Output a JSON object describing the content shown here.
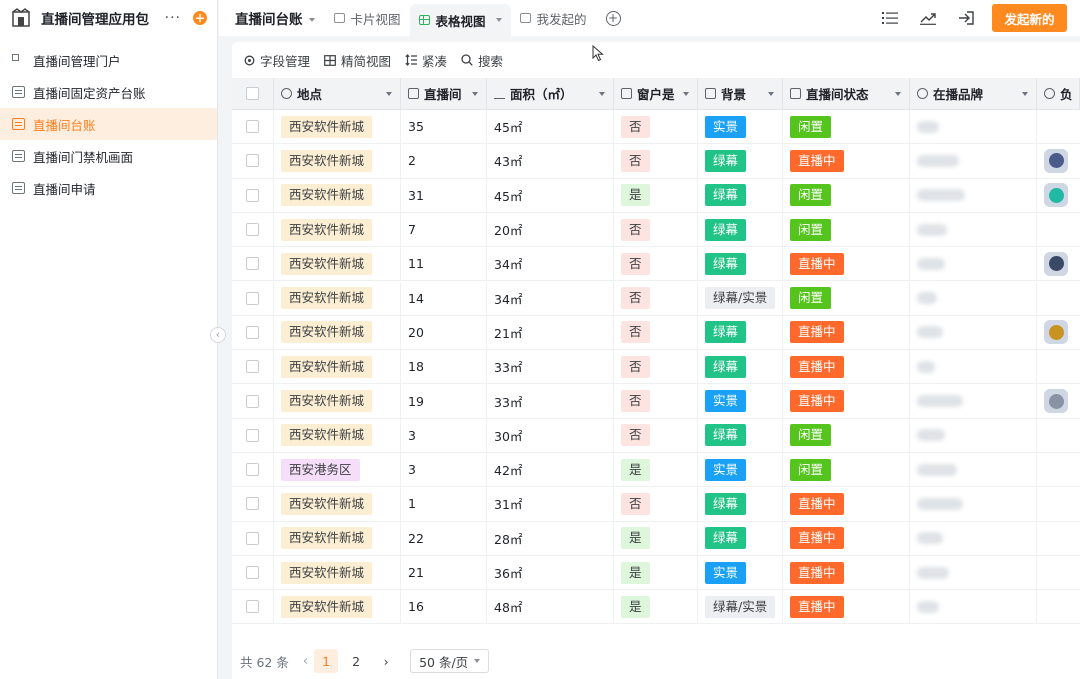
{
  "app": {
    "title": "直播间管理应用包",
    "more": "···",
    "add": "+"
  },
  "sidebar": {
    "items": [
      {
        "label": "直播间管理门户",
        "icon": "portal-icon",
        "active": false
      },
      {
        "label": "直播间固定资产台账",
        "icon": "table-icon",
        "active": false
      },
      {
        "label": "直播间台账",
        "icon": "table-icon",
        "active": true
      },
      {
        "label": "直播间门禁机画面",
        "icon": "table-icon",
        "active": false
      },
      {
        "label": "直播间申请",
        "icon": "table-icon",
        "active": false
      }
    ],
    "collapse": "‹"
  },
  "topbar": {
    "title": "直播间台账",
    "tabs": [
      {
        "label": "卡片视图",
        "active": false
      },
      {
        "label": "表格视图",
        "active": true
      },
      {
        "label": "我发起的",
        "active": false
      }
    ],
    "add_tab": "+",
    "primary_button": "发起新的"
  },
  "toolbar": {
    "field_manage": "字段管理",
    "simple_view": "精简视图",
    "compact": "紧凑",
    "search": "搜索"
  },
  "table": {
    "columns": [
      "地点",
      "直播间",
      "面积（㎡）",
      "窗户是",
      "背景",
      "直播间状态",
      "在播品牌",
      "负"
    ],
    "rows": [
      {
        "loc": "西安软件新城",
        "num": "35",
        "area": "45㎡",
        "win": "否",
        "bg": "实景",
        "status": "闲置",
        "avatar": false
      },
      {
        "loc": "西安软件新城",
        "num": "2",
        "area": "43㎡",
        "win": "否",
        "bg": "绿幕",
        "status": "直播中",
        "avatar": true
      },
      {
        "loc": "西安软件新城",
        "num": "31",
        "area": "45㎡",
        "win": "是",
        "bg": "绿幕",
        "status": "闲置",
        "avatar": true
      },
      {
        "loc": "西安软件新城",
        "num": "7",
        "area": "20㎡",
        "win": "否",
        "bg": "绿幕",
        "status": "闲置",
        "avatar": false
      },
      {
        "loc": "西安软件新城",
        "num": "11",
        "area": "34㎡",
        "win": "否",
        "bg": "绿幕",
        "status": "直播中",
        "avatar": true
      },
      {
        "loc": "西安软件新城",
        "num": "14",
        "area": "34㎡",
        "win": "否",
        "bg": "绿幕/实景",
        "status": "闲置",
        "avatar": false
      },
      {
        "loc": "西安软件新城",
        "num": "20",
        "area": "21㎡",
        "win": "否",
        "bg": "绿幕",
        "status": "直播中",
        "avatar": true
      },
      {
        "loc": "西安软件新城",
        "num": "18",
        "area": "33㎡",
        "win": "否",
        "bg": "绿幕",
        "status": "直播中",
        "avatar": false
      },
      {
        "loc": "西安软件新城",
        "num": "19",
        "area": "33㎡",
        "win": "否",
        "bg": "实景",
        "status": "直播中",
        "avatar": true
      },
      {
        "loc": "西安软件新城",
        "num": "3",
        "area": "30㎡",
        "win": "否",
        "bg": "绿幕",
        "status": "闲置",
        "avatar": false
      },
      {
        "loc": "西安港务区",
        "num": "3",
        "area": "42㎡",
        "win": "是",
        "bg": "实景",
        "status": "闲置",
        "avatar": false
      },
      {
        "loc": "西安软件新城",
        "num": "1",
        "area": "31㎡",
        "win": "否",
        "bg": "绿幕",
        "status": "直播中",
        "avatar": false
      },
      {
        "loc": "西安软件新城",
        "num": "22",
        "area": "28㎡",
        "win": "是",
        "bg": "绿幕",
        "status": "直播中",
        "avatar": false
      },
      {
        "loc": "西安软件新城",
        "num": "21",
        "area": "36㎡",
        "win": "是",
        "bg": "实景",
        "status": "直播中",
        "avatar": false
      },
      {
        "loc": "西安软件新城",
        "num": "16",
        "area": "48㎡",
        "win": "是",
        "bg": "绿幕/实景",
        "status": "直播中",
        "avatar": false
      }
    ]
  },
  "footer": {
    "total": "共 62 条",
    "prev": "‹",
    "pages": [
      "1",
      "2"
    ],
    "next": "›",
    "page_size": "50 条/页"
  },
  "colors": {
    "accent": "#ff8a1f",
    "live": "#ff6a2c",
    "idle": "#55c51e",
    "green_screen": "#22c386",
    "real_scene": "#1aa1f5"
  }
}
